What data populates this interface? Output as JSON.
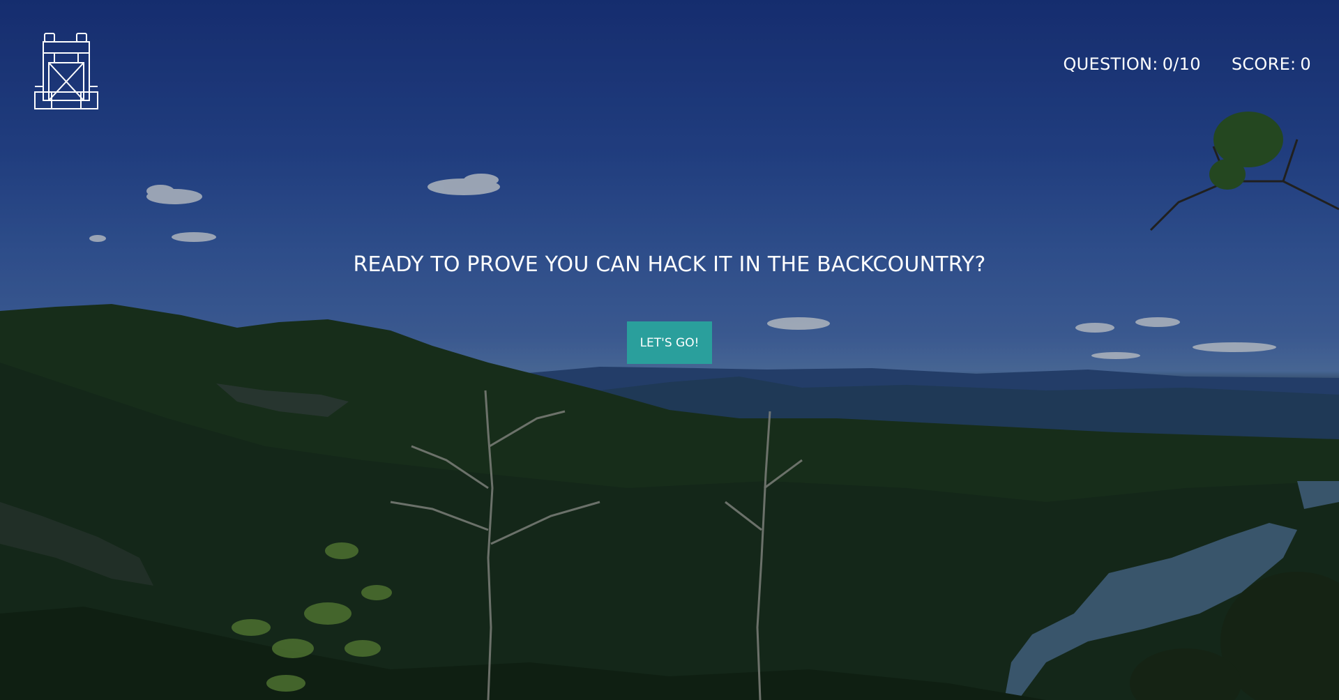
{
  "header": {
    "logo_icon": "backpack-icon",
    "question_label": "QUESTION:",
    "question_value": "0/10",
    "score_label": "SCORE:",
    "score_value": "0"
  },
  "main": {
    "headline": "READY TO PROVE YOU CAN HACK IT IN THE BACKCOUNTRY?",
    "start_button_label": "LET'S GO!"
  },
  "colors": {
    "button": "#2a9f9c",
    "text": "#ffffff",
    "sky": "#2a4fa2"
  }
}
